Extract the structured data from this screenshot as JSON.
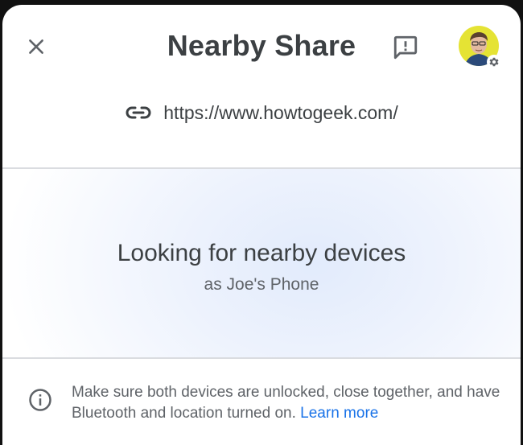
{
  "header": {
    "title": "Nearby Share",
    "close_icon": "close-icon",
    "feedback_icon": "feedback-icon",
    "avatar_icon": "avatar",
    "settings_icon": "gear-icon"
  },
  "share": {
    "link_icon": "link-icon",
    "url": "https://www.howtogeek.com/"
  },
  "status": {
    "title": "Looking for nearby devices",
    "subtitle": "as Joe's Phone"
  },
  "info": {
    "icon": "info-icon",
    "text": "Make sure both devices are unlocked, close together, and have Bluetooth and location turned on.",
    "link_label": "Learn more"
  },
  "colors": {
    "text_primary": "#3c4043",
    "text_secondary": "#5f6368",
    "link": "#1a73e8",
    "divider": "#dadce0",
    "scan_glow": "#e2ebfc"
  }
}
